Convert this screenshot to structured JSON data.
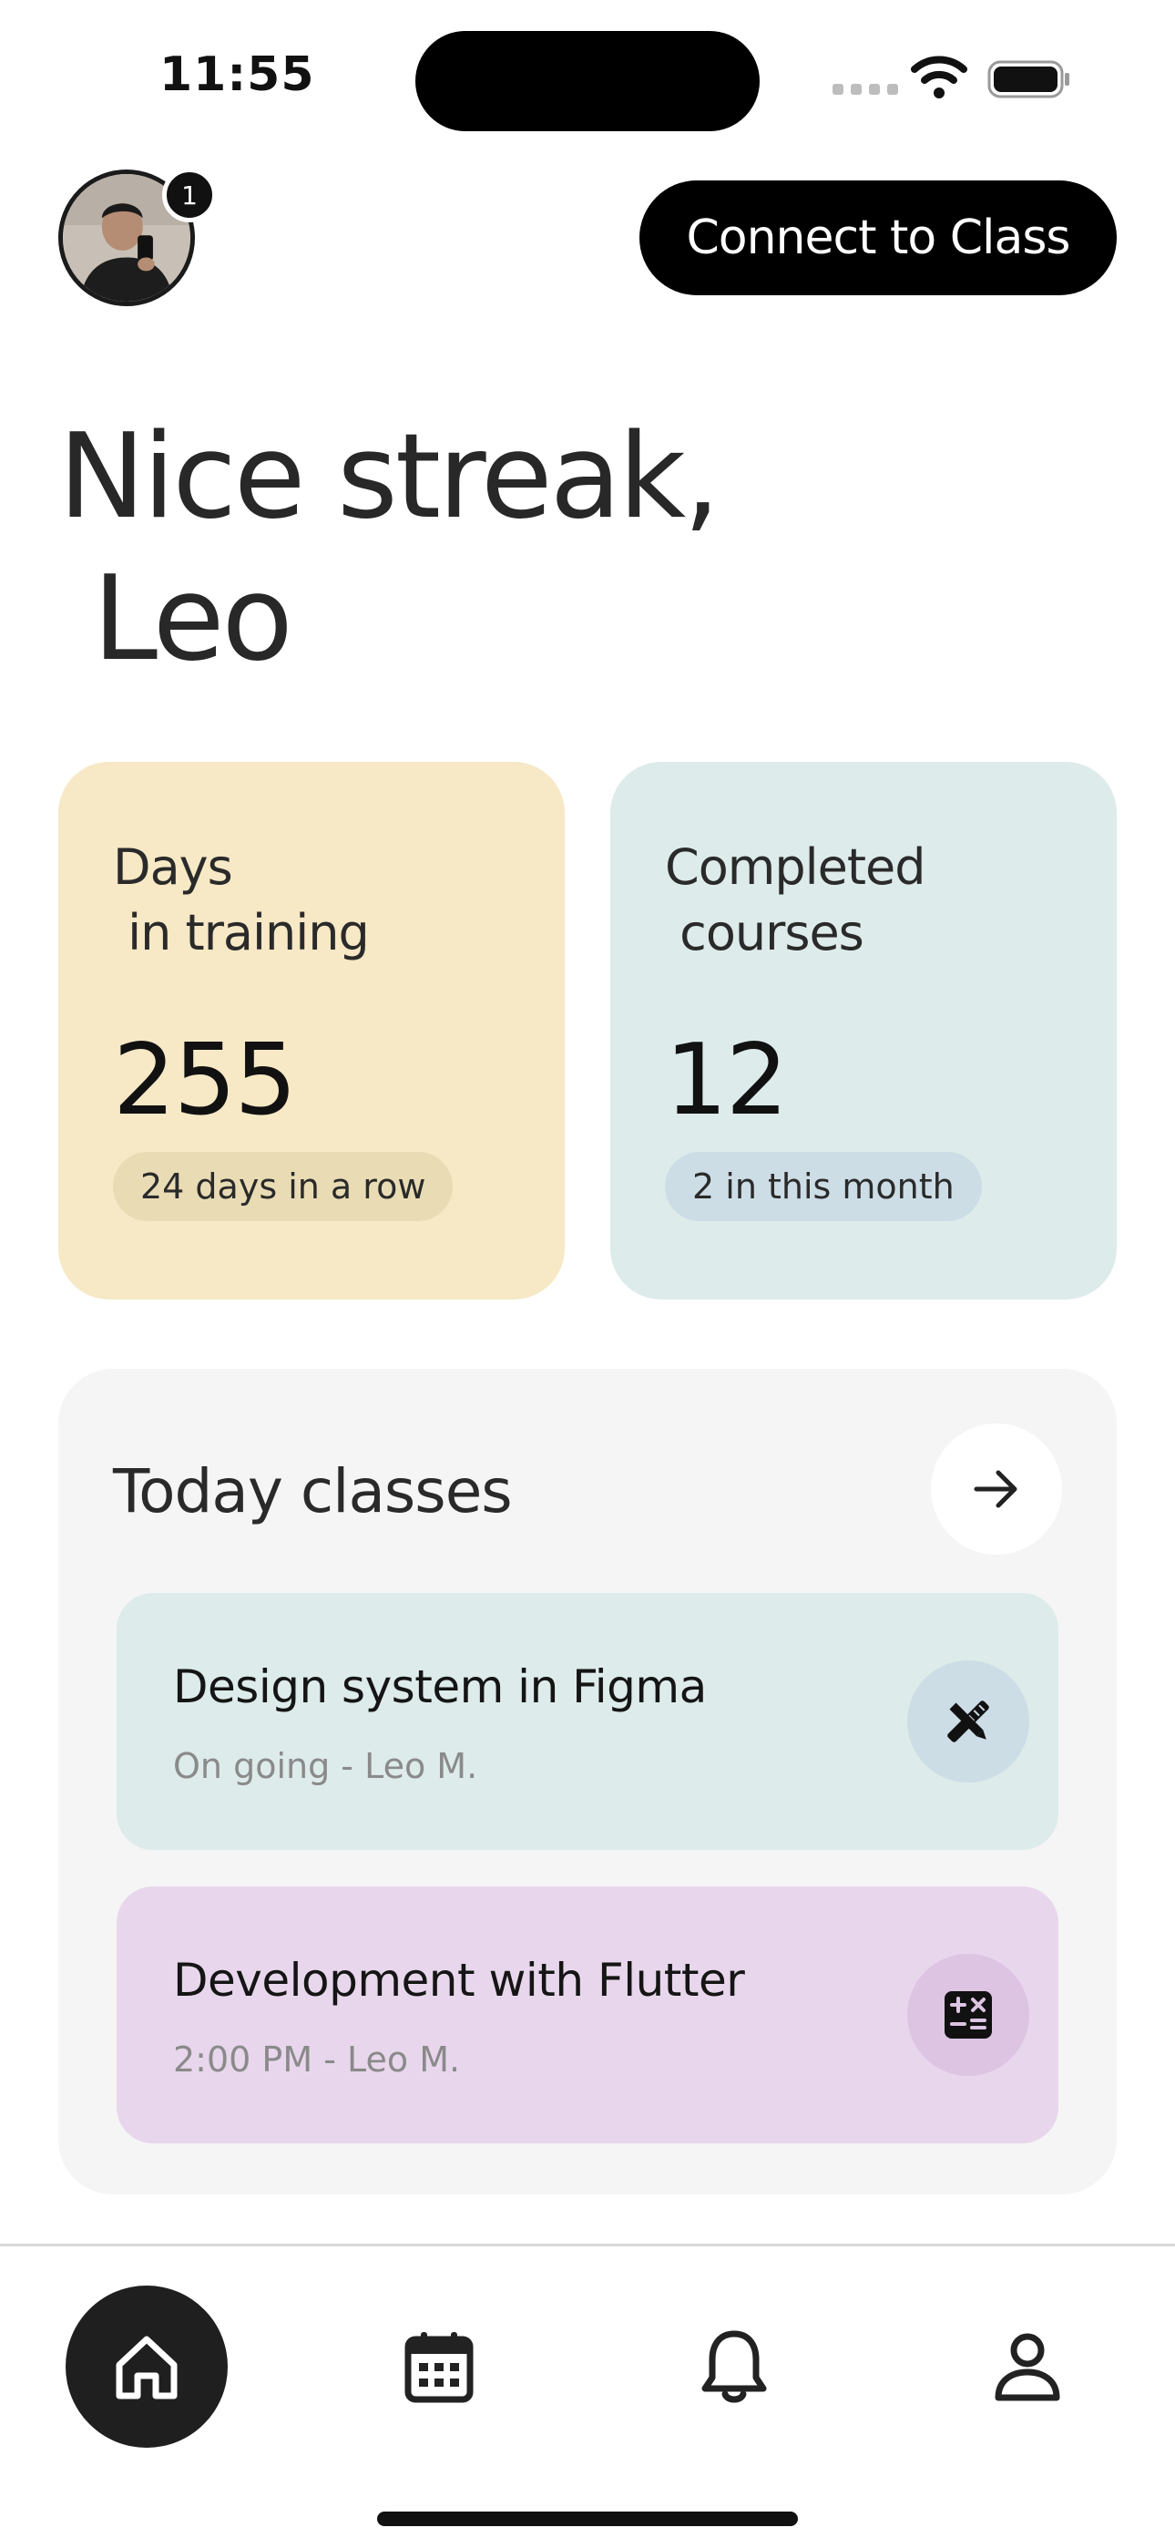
{
  "status_bar": {
    "time": "11:55",
    "icons": [
      "cellular-signal-icon",
      "wifi-icon",
      "battery-icon"
    ]
  },
  "header": {
    "avatar_alt": "profile-photo",
    "notification_count": "1",
    "connect_label": "Connect to Class"
  },
  "greeting": {
    "text": "Nice streak,\n Leo"
  },
  "stats": [
    {
      "label": "Days\n in training",
      "value": "255",
      "chip": "24 days in a row",
      "color": "#f7e8c6"
    },
    {
      "label": "Completed\n courses",
      "value": "12",
      "chip": "2 in this month",
      "color": "#ddebea"
    }
  ],
  "today": {
    "title": "Today classes",
    "arrow_icon": "arrow-right-icon",
    "classes": [
      {
        "title": "Design system in Figma",
        "subtitle": "On going - Leo M.",
        "icon": "design-tools-icon",
        "color": "#ddebea"
      },
      {
        "title": "Development with Flutter",
        "subtitle": "2:00 PM - Leo M.",
        "icon": "calculator-icon",
        "color": "#e8d7ec"
      }
    ]
  },
  "bottom_nav": {
    "items": [
      {
        "icon": "home-icon",
        "active": true
      },
      {
        "icon": "calendar-icon",
        "active": false
      },
      {
        "icon": "bell-icon",
        "active": false
      },
      {
        "icon": "profile-icon",
        "active": false
      }
    ]
  }
}
